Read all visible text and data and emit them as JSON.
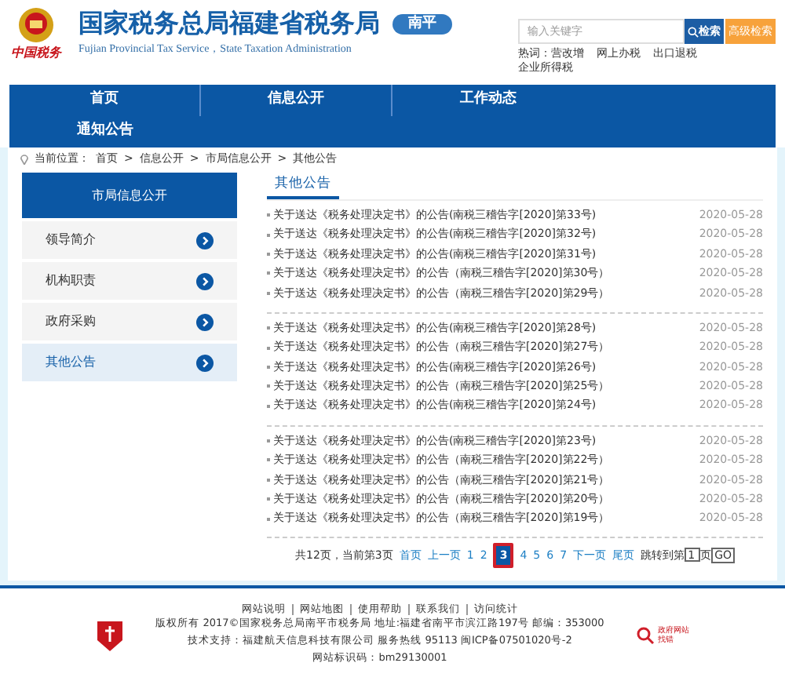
{
  "header": {
    "title": "国家税务总局福建省税务局",
    "subtitle": "Fujian Provincial Tax Service，State Taxation Administration",
    "emblem_caption": "中国税务",
    "region": "南平",
    "search": {
      "placeholder": "输入关键字",
      "button": "检索",
      "advanced": "高级检索"
    },
    "hot_label": "热词：",
    "hot_words": [
      "营改增",
      "网上办税",
      "出口退税",
      "企业所得税"
    ]
  },
  "nav": [
    {
      "label": "首页",
      "selected": false
    },
    {
      "label": "信息公开",
      "selected": false
    },
    {
      "label": "工作动态",
      "selected": false
    },
    {
      "label": "通知公告",
      "selected": false
    }
  ],
  "breadcrumb": {
    "label": "当前位置：",
    "items": [
      "首页",
      "信息公开",
      "市局信息公开",
      "其他公告"
    ],
    "separator": ">"
  },
  "sidebar": {
    "title": "市局信息公开",
    "items": [
      {
        "label": "领导简介",
        "selected": false
      },
      {
        "label": "机构职责",
        "selected": false
      },
      {
        "label": "政府采购",
        "selected": false
      },
      {
        "label": "其他公告",
        "selected": true
      }
    ]
  },
  "content": {
    "title": "其他公告",
    "groups": [
      [
        {
          "title": "关于送达《税务处理决定书》的公告(南税三稽告字[2020]第33号)",
          "date": "2020-05-28"
        },
        {
          "title": "关于送达《税务处理决定书》的公告(南税三稽告字[2020]第32号)",
          "date": "2020-05-28"
        },
        {
          "title": "关于送达《税务处理决定书》的公告(南税三稽告字[2020]第31号)",
          "date": "2020-05-28"
        },
        {
          "title": "关于送达《税务处理决定书》的公告（南税三稽告字[2020]第30号）",
          "date": "2020-05-28"
        },
        {
          "title": "关于送达《税务处理决定书》的公告（南税三稽告字[2020]第29号）",
          "date": "2020-05-28"
        }
      ],
      [
        {
          "title": "关于送达《税务处理决定书》的公告(南税三稽告字[2020]第28号)",
          "date": "2020-05-28"
        },
        {
          "title": "关于送达《税务处理决定书》的公告（南税三稽告字[2020]第27号）",
          "date": "2020-05-28"
        },
        {
          "title": "关于送达《税务处理决定书》的公告(南税三稽告字[2020]第26号)",
          "date": "2020-05-28"
        },
        {
          "title": "关于送达《税务处理决定书》的公告（南税三稽告字[2020]第25号）",
          "date": "2020-05-28"
        },
        {
          "title": "关于送达《税务处理决定书》的公告(南税三稽告字[2020]第24号)",
          "date": "2020-05-28"
        }
      ],
      [
        {
          "title": "关于送达《税务处理决定书》的公告(南税三稽告字[2020]第23号)",
          "date": "2020-05-28"
        },
        {
          "title": "关于送达《税务处理决定书》的公告（南税三稽告字[2020]第22号）",
          "date": "2020-05-28"
        },
        {
          "title": "关于送达《税务处理决定书》的公告（南税三稽告字[2020]第21号）",
          "date": "2020-05-28"
        },
        {
          "title": "关于送达《税务处理决定书》的公告（南税三稽告字[2020]第20号）",
          "date": "2020-05-28"
        },
        {
          "title": "关于送达《税务处理决定书》的公告（南税三稽告字[2020]第19号）",
          "date": "2020-05-28"
        }
      ]
    ]
  },
  "pagination": {
    "summary": "共12页，当前第3页",
    "first": "首页",
    "prev": "上一页",
    "pages": [
      {
        "label": "1",
        "selected": false
      },
      {
        "label": "2",
        "selected": false
      },
      {
        "label": "3",
        "selected": true
      },
      {
        "label": "4",
        "selected": false
      },
      {
        "label": "5",
        "selected": false
      },
      {
        "label": "6",
        "selected": false
      },
      {
        "label": "7",
        "selected": false
      }
    ],
    "next": "下一页",
    "last": "尾页",
    "jump_label": "跳转到第",
    "jump_value": "1",
    "jump_suffix": "页",
    "go": "GO"
  },
  "footer": {
    "links": [
      "网站说明",
      "网站地图",
      "使用帮助",
      "联系我们",
      "访问统计"
    ],
    "lines": [
      "版权所有 2017©国家税务总局南平市税务局 地址:福建省南平市滨江路197号 邮编：353000",
      "技术支持：福建航天信息科技有限公司 服务热线 95113 闽ICP备07501020号-2",
      "网站标识码：bm29130001"
    ],
    "badge_title": "政府网站",
    "badge_action": "找错"
  }
}
